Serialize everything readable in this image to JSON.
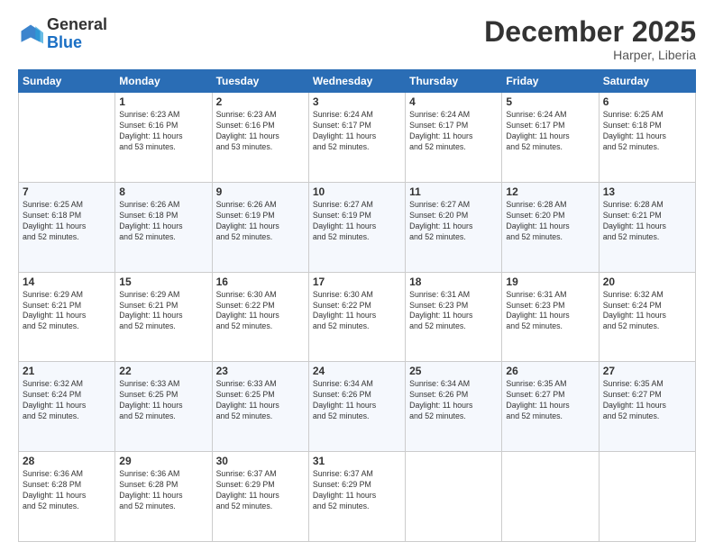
{
  "logo": {
    "general": "General",
    "blue": "Blue"
  },
  "title": "December 2025",
  "subtitle": "Harper, Liberia",
  "days_of_week": [
    "Sunday",
    "Monday",
    "Tuesday",
    "Wednesday",
    "Thursday",
    "Friday",
    "Saturday"
  ],
  "weeks": [
    [
      {
        "day": "",
        "info": ""
      },
      {
        "day": "1",
        "info": "Sunrise: 6:23 AM\nSunset: 6:16 PM\nDaylight: 11 hours\nand 53 minutes."
      },
      {
        "day": "2",
        "info": "Sunrise: 6:23 AM\nSunset: 6:16 PM\nDaylight: 11 hours\nand 53 minutes."
      },
      {
        "day": "3",
        "info": "Sunrise: 6:24 AM\nSunset: 6:17 PM\nDaylight: 11 hours\nand 52 minutes."
      },
      {
        "day": "4",
        "info": "Sunrise: 6:24 AM\nSunset: 6:17 PM\nDaylight: 11 hours\nand 52 minutes."
      },
      {
        "day": "5",
        "info": "Sunrise: 6:24 AM\nSunset: 6:17 PM\nDaylight: 11 hours\nand 52 minutes."
      },
      {
        "day": "6",
        "info": "Sunrise: 6:25 AM\nSunset: 6:18 PM\nDaylight: 11 hours\nand 52 minutes."
      }
    ],
    [
      {
        "day": "7",
        "info": "Sunrise: 6:25 AM\nSunset: 6:18 PM\nDaylight: 11 hours\nand 52 minutes."
      },
      {
        "day": "8",
        "info": "Sunrise: 6:26 AM\nSunset: 6:18 PM\nDaylight: 11 hours\nand 52 minutes."
      },
      {
        "day": "9",
        "info": "Sunrise: 6:26 AM\nSunset: 6:19 PM\nDaylight: 11 hours\nand 52 minutes."
      },
      {
        "day": "10",
        "info": "Sunrise: 6:27 AM\nSunset: 6:19 PM\nDaylight: 11 hours\nand 52 minutes."
      },
      {
        "day": "11",
        "info": "Sunrise: 6:27 AM\nSunset: 6:20 PM\nDaylight: 11 hours\nand 52 minutes."
      },
      {
        "day": "12",
        "info": "Sunrise: 6:28 AM\nSunset: 6:20 PM\nDaylight: 11 hours\nand 52 minutes."
      },
      {
        "day": "13",
        "info": "Sunrise: 6:28 AM\nSunset: 6:21 PM\nDaylight: 11 hours\nand 52 minutes."
      }
    ],
    [
      {
        "day": "14",
        "info": "Sunrise: 6:29 AM\nSunset: 6:21 PM\nDaylight: 11 hours\nand 52 minutes."
      },
      {
        "day": "15",
        "info": "Sunrise: 6:29 AM\nSunset: 6:21 PM\nDaylight: 11 hours\nand 52 minutes."
      },
      {
        "day": "16",
        "info": "Sunrise: 6:30 AM\nSunset: 6:22 PM\nDaylight: 11 hours\nand 52 minutes."
      },
      {
        "day": "17",
        "info": "Sunrise: 6:30 AM\nSunset: 6:22 PM\nDaylight: 11 hours\nand 52 minutes."
      },
      {
        "day": "18",
        "info": "Sunrise: 6:31 AM\nSunset: 6:23 PM\nDaylight: 11 hours\nand 52 minutes."
      },
      {
        "day": "19",
        "info": "Sunrise: 6:31 AM\nSunset: 6:23 PM\nDaylight: 11 hours\nand 52 minutes."
      },
      {
        "day": "20",
        "info": "Sunrise: 6:32 AM\nSunset: 6:24 PM\nDaylight: 11 hours\nand 52 minutes."
      }
    ],
    [
      {
        "day": "21",
        "info": "Sunrise: 6:32 AM\nSunset: 6:24 PM\nDaylight: 11 hours\nand 52 minutes."
      },
      {
        "day": "22",
        "info": "Sunrise: 6:33 AM\nSunset: 6:25 PM\nDaylight: 11 hours\nand 52 minutes."
      },
      {
        "day": "23",
        "info": "Sunrise: 6:33 AM\nSunset: 6:25 PM\nDaylight: 11 hours\nand 52 minutes."
      },
      {
        "day": "24",
        "info": "Sunrise: 6:34 AM\nSunset: 6:26 PM\nDaylight: 11 hours\nand 52 minutes."
      },
      {
        "day": "25",
        "info": "Sunrise: 6:34 AM\nSunset: 6:26 PM\nDaylight: 11 hours\nand 52 minutes."
      },
      {
        "day": "26",
        "info": "Sunrise: 6:35 AM\nSunset: 6:27 PM\nDaylight: 11 hours\nand 52 minutes."
      },
      {
        "day": "27",
        "info": "Sunrise: 6:35 AM\nSunset: 6:27 PM\nDaylight: 11 hours\nand 52 minutes."
      }
    ],
    [
      {
        "day": "28",
        "info": "Sunrise: 6:36 AM\nSunset: 6:28 PM\nDaylight: 11 hours\nand 52 minutes."
      },
      {
        "day": "29",
        "info": "Sunrise: 6:36 AM\nSunset: 6:28 PM\nDaylight: 11 hours\nand 52 minutes."
      },
      {
        "day": "30",
        "info": "Sunrise: 6:37 AM\nSunset: 6:29 PM\nDaylight: 11 hours\nand 52 minutes."
      },
      {
        "day": "31",
        "info": "Sunrise: 6:37 AM\nSunset: 6:29 PM\nDaylight: 11 hours\nand 52 minutes."
      },
      {
        "day": "",
        "info": ""
      },
      {
        "day": "",
        "info": ""
      },
      {
        "day": "",
        "info": ""
      }
    ]
  ]
}
